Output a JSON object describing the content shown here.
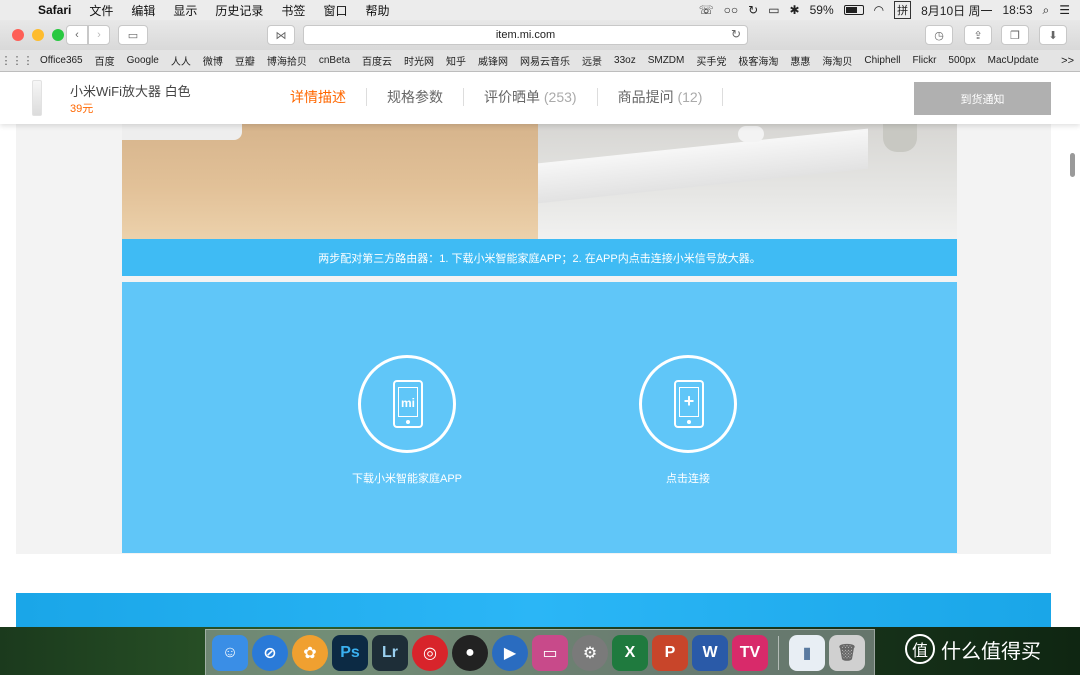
{
  "menubar": {
    "app": "Safari",
    "items": [
      "文件",
      "编辑",
      "显示",
      "历史记录",
      "书签",
      "窗口",
      "帮助"
    ],
    "battery": "59%",
    "ime": "拼",
    "date": "8月10日 周一",
    "time": "18:53"
  },
  "toolbar": {
    "url": "item.mi.com"
  },
  "bookmarks": {
    "items": [
      "Office365",
      "百度",
      "Google",
      "人人",
      "微博",
      "豆瓣",
      "博海拾贝",
      "cnBeta",
      "百度云",
      "时光网",
      "知乎",
      "威锋网",
      "网易云音乐",
      "远景",
      "33oz",
      "SMZDM",
      "买手党",
      "极客海淘",
      "惠惠",
      "海淘贝",
      "Chiphell",
      "Flickr",
      "500px",
      "MacUpdate"
    ],
    "more": ">>"
  },
  "product": {
    "name": "小米WiFi放大器 白色",
    "price": "39元",
    "tabs": [
      {
        "label": "详情描述",
        "count": ""
      },
      {
        "label": "规格参数",
        "count": ""
      },
      {
        "label": "评价晒单",
        "count": "(253)"
      },
      {
        "label": "商品提问",
        "count": "(12)"
      }
    ],
    "notify_button": "到货通知"
  },
  "content": {
    "caption": "两步配对第三方路由器：1. 下载小米智能家庭APP；2. 在APP内点击连接小米信号放大器。",
    "step1_glyph": "mi",
    "step1_label": "下载小米智能家庭APP",
    "step2_glyph": "+",
    "step2_label": "点击连接"
  },
  "dock": {
    "watermark": "什么值得买",
    "watermark_glyph": "值",
    "apps": [
      {
        "name": "finder",
        "glyph": "☺",
        "color": "#3a8ee6"
      },
      {
        "name": "safari",
        "glyph": "⊘",
        "color": "#2a7ad8"
      },
      {
        "name": "photos",
        "glyph": "✿",
        "color": "#f0a030"
      },
      {
        "name": "photoshop",
        "glyph": "Ps",
        "color": "#0c2a44"
      },
      {
        "name": "lightroom",
        "glyph": "Lr",
        "color": "#1e2e38"
      },
      {
        "name": "netease-music",
        "glyph": "◎",
        "color": "#d8242b"
      },
      {
        "name": "qq",
        "glyph": "●",
        "color": "#222222"
      },
      {
        "name": "quicktime",
        "glyph": "▶",
        "color": "#2a6cc0"
      },
      {
        "name": "display",
        "glyph": "▭",
        "color": "#c84a8a"
      },
      {
        "name": "system-preferences",
        "glyph": "⚙",
        "color": "#7a7a7a"
      },
      {
        "name": "excel",
        "glyph": "X",
        "color": "#1f7a3e"
      },
      {
        "name": "powerpoint",
        "glyph": "P",
        "color": "#c8452a"
      },
      {
        "name": "word",
        "glyph": "W",
        "color": "#2a5aa8"
      },
      {
        "name": "tv-app",
        "glyph": "TV",
        "color": "#d82a6a"
      }
    ],
    "downloads_glyph": "▮",
    "trash_glyph": "🗑"
  }
}
